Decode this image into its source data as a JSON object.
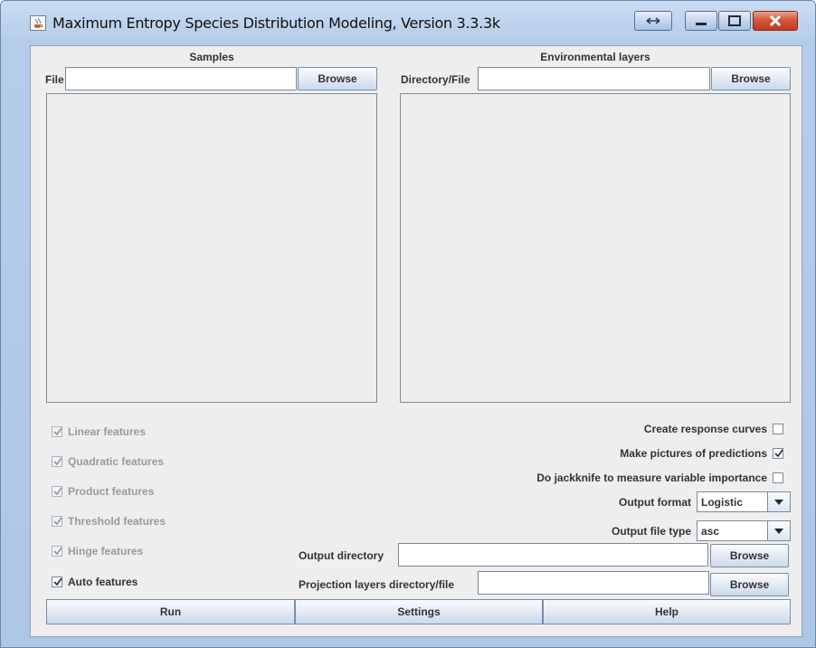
{
  "window": {
    "title": "Maximum Entropy Species Distribution Modeling, Version 3.3.3k",
    "icon": "java-cup-icon",
    "controls": [
      "resize-icon",
      "minimize-icon",
      "maximize-icon",
      "close-icon"
    ]
  },
  "samples": {
    "header": "Samples",
    "file_label": "File",
    "file_value": "",
    "browse_label": "Browse"
  },
  "env_layers": {
    "header": "Environmental layers",
    "dir_label": "Directory/File",
    "dir_value": "",
    "browse_label": "Browse"
  },
  "features": [
    {
      "label": "Linear features",
      "checked": true,
      "enabled": false
    },
    {
      "label": "Quadratic features",
      "checked": true,
      "enabled": false
    },
    {
      "label": "Product features",
      "checked": true,
      "enabled": false
    },
    {
      "label": "Threshold features",
      "checked": true,
      "enabled": false
    },
    {
      "label": "Hinge features",
      "checked": true,
      "enabled": false
    },
    {
      "label": "Auto features",
      "checked": true,
      "enabled": true
    }
  ],
  "options": [
    {
      "label": "Create response curves",
      "checked": false
    },
    {
      "label": "Make pictures of predictions",
      "checked": true
    },
    {
      "label": "Do jackknife to measure variable importance",
      "checked": false
    }
  ],
  "output_format": {
    "label": "Output format",
    "value": "Logistic"
  },
  "output_file_type": {
    "label": "Output file type",
    "value": "asc"
  },
  "output_directory": {
    "label": "Output directory",
    "value": "",
    "browse_label": "Browse"
  },
  "projection_layers": {
    "label": "Projection layers directory/file",
    "value": "",
    "browse_label": "Browse"
  },
  "bottom_buttons": {
    "run": "Run",
    "settings": "Settings",
    "help": "Help"
  },
  "colors": {
    "titlebar": "#b6cde9",
    "panel": "#eeeeee",
    "close": "#c33a1e",
    "disabled_text": "#9a9a9a"
  }
}
